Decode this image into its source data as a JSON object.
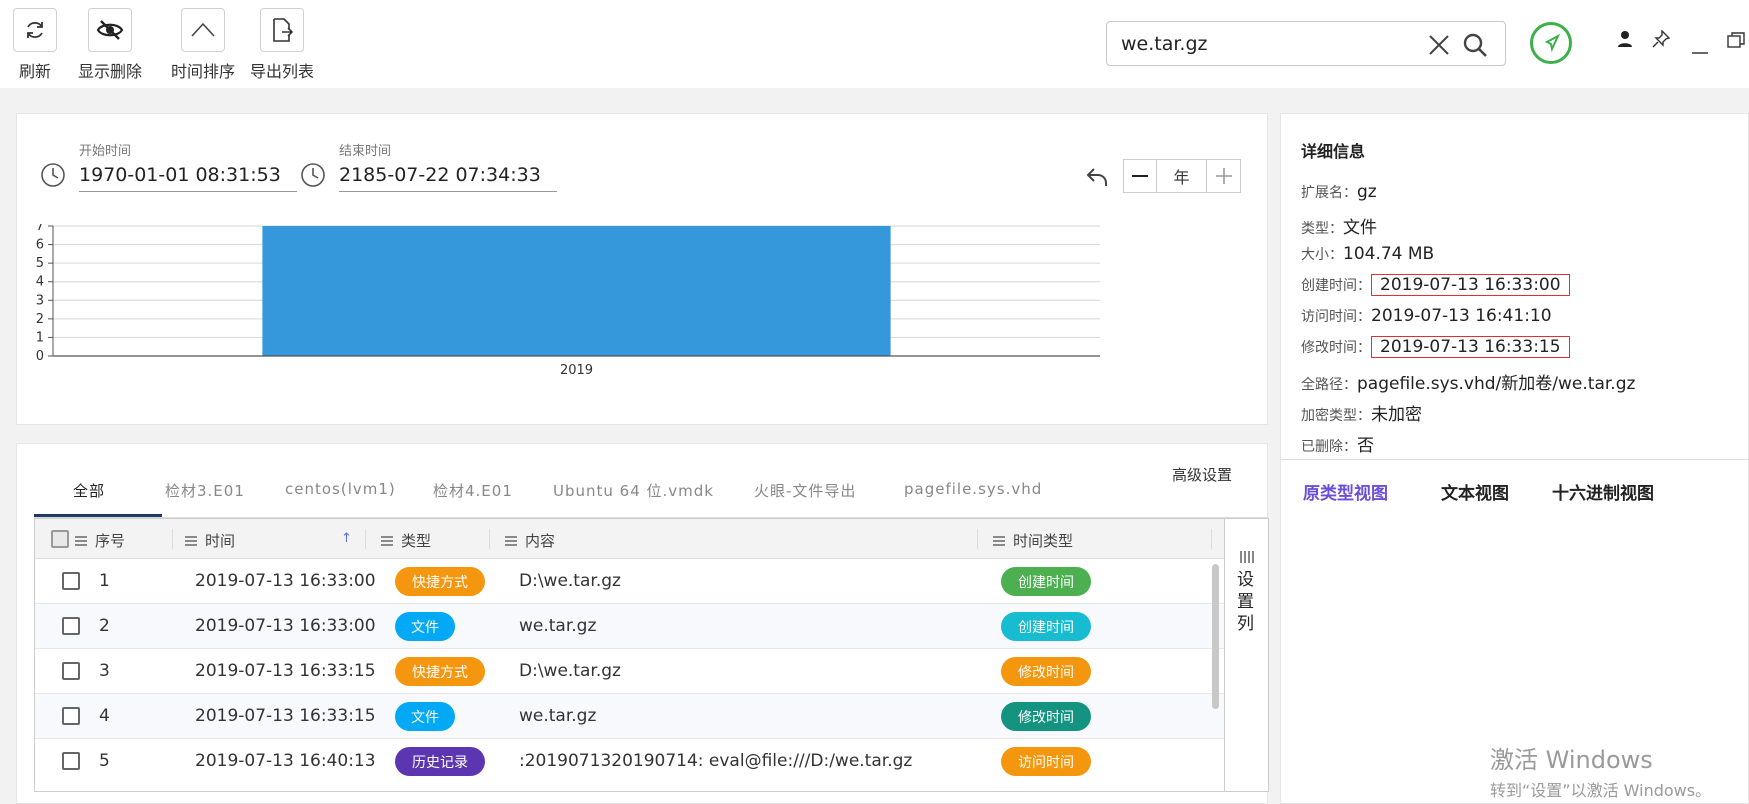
{
  "toolbar": {
    "refresh_label": "刷新",
    "show_deleted_label": "显示删除",
    "time_sort_label": "时间排序",
    "export_label": "导出列表"
  },
  "search": {
    "value": "we.tar.gz"
  },
  "time_range": {
    "start_label": "开始时间",
    "start_value": "1970-01-01 08:31:53",
    "end_label": "结束时间",
    "end_value": "2185-07-22 07:34:33",
    "zoom_unit": "年"
  },
  "chart_data": {
    "type": "bar",
    "categories": [
      "2019"
    ],
    "values": [
      7
    ],
    "ylim": [
      0,
      7
    ],
    "yticks": [
      "0",
      "1",
      "2",
      "3",
      "4",
      "5",
      "6",
      "7"
    ],
    "xlabel": "",
    "ylabel": "",
    "grid": true,
    "color": "#3498db"
  },
  "tabs": [
    "全部",
    "检材3.E01",
    "centos(lvm1)",
    "检材4.E01",
    "Ubuntu 64 位.vmdk",
    "火眼-文件导出",
    "pagefile.sys.vhd"
  ],
  "advanced_label": "高级设置",
  "table": {
    "headers": {
      "index": "序号",
      "time": "时间",
      "type": "类型",
      "content": "内容",
      "time_type": "时间类型"
    },
    "sort_indicator": "↑",
    "column_settings_label": "设置列",
    "rows": [
      {
        "index": "1",
        "time": "2019-07-13 16:33:00",
        "type": "快捷方式",
        "type_color": "#f5960f",
        "content": "D:\\we.tar.gz",
        "time_type": "创建时间",
        "time_type_color": "#4caf50"
      },
      {
        "index": "2",
        "time": "2019-07-13 16:33:00",
        "type": "文件",
        "type_color": "#03a9f4",
        "content": "we.tar.gz",
        "time_type": "创建时间",
        "time_type_color": "#17bcd0"
      },
      {
        "index": "3",
        "time": "2019-07-13 16:33:15",
        "type": "快捷方式",
        "type_color": "#f5960f",
        "content": "D:\\we.tar.gz",
        "time_type": "修改时间",
        "time_type_color": "#f5960f"
      },
      {
        "index": "4",
        "time": "2019-07-13 16:33:15",
        "type": "文件",
        "type_color": "#03a9f4",
        "content": "we.tar.gz",
        "time_type": "修改时间",
        "time_type_color": "#159381"
      },
      {
        "index": "5",
        "time": "2019-07-13 16:40:13",
        "type": "历史记录",
        "type_color": "#5c35b0",
        "content": ":2019071320190714: eval@file:///D:/we.tar.gz",
        "time_type": "访问时间",
        "time_type_color": "#f5960f"
      }
    ]
  },
  "detail": {
    "title": "详细信息",
    "fields": [
      {
        "key": "扩展名：",
        "value": "gz"
      },
      {
        "key": "类型：",
        "value": "文件"
      },
      {
        "key": "大小：",
        "value": "104.74 MB"
      },
      {
        "key": "创建时间：",
        "value": "2019-07-13 16:33:00",
        "highlight": true
      },
      {
        "key": "访问时间：",
        "value": "2019-07-13 16:41:10"
      },
      {
        "key": "修改时间：",
        "value": "2019-07-13 16:33:15",
        "highlight": true
      },
      {
        "key": "全路径：",
        "value": "pagefile.sys.vhd/新加卷/we.tar.gz"
      },
      {
        "key": "加密类型：",
        "value": "未加密"
      },
      {
        "key": "已删除：",
        "value": "否"
      }
    ],
    "views": [
      "原类型视图",
      "文本视图",
      "十六进制视图"
    ]
  },
  "watermark": {
    "line1": "激活 Windows",
    "line2": "转到“设置”以激活 Windows。"
  }
}
